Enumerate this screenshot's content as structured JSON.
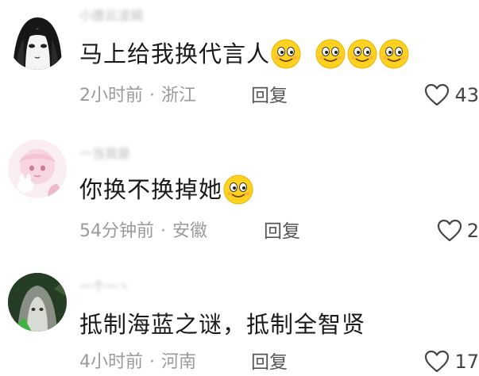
{
  "comments": [
    {
      "username": "小唐云凌娟",
      "content": "马上给我换代言人",
      "emojis": [
        "smile-emoji",
        "smile-emoji",
        "smile-emoji",
        "smile-emoji"
      ],
      "time": "2小时前",
      "location": "浙江",
      "reply_label": "回复",
      "likes": "43"
    },
    {
      "username": "一当我是",
      "content": "你换不换掉她",
      "emojis": [
        "smile-emoji"
      ],
      "time": "54分钟前",
      "location": "安徽",
      "reply_label": "回复",
      "likes": "2"
    },
    {
      "username": "一个一丶",
      "content": "抵制海蓝之谜，抵制全智贤",
      "emojis": [],
      "time": "4小时前",
      "location": "河南",
      "reply_label": "回复",
      "likes": "17"
    }
  ],
  "meta_separator": "·",
  "colors": {
    "meta_text": "#9a9a9a",
    "content_text": "#1a1a1a",
    "emoji_face": "#ffd21f"
  }
}
